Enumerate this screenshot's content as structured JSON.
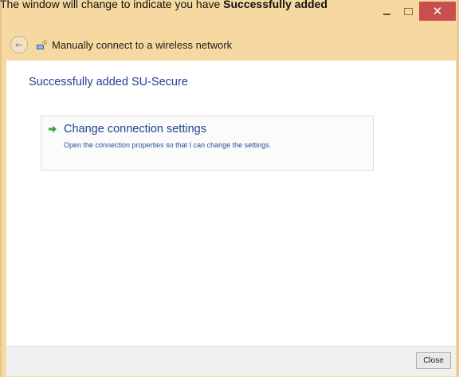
{
  "caption": {
    "prefix": "The window will change to indicate you have ",
    "bold": "Successfully added"
  },
  "window": {
    "title": "Manually connect to a wireless network",
    "controls": {
      "minimize": "minimize",
      "maximize": "maximize",
      "close": "✕"
    }
  },
  "main": {
    "heading": "Successfully added SU-Secure",
    "option": {
      "title": "Change connection settings",
      "description": "Open the connection properties so that I can change the settings."
    }
  },
  "footer": {
    "close_label": "Close"
  },
  "colors": {
    "frame": "#f6d9a0",
    "close_button": "#c7504f",
    "link_text": "#1f3f8f",
    "arrow": "#2fa84a"
  }
}
